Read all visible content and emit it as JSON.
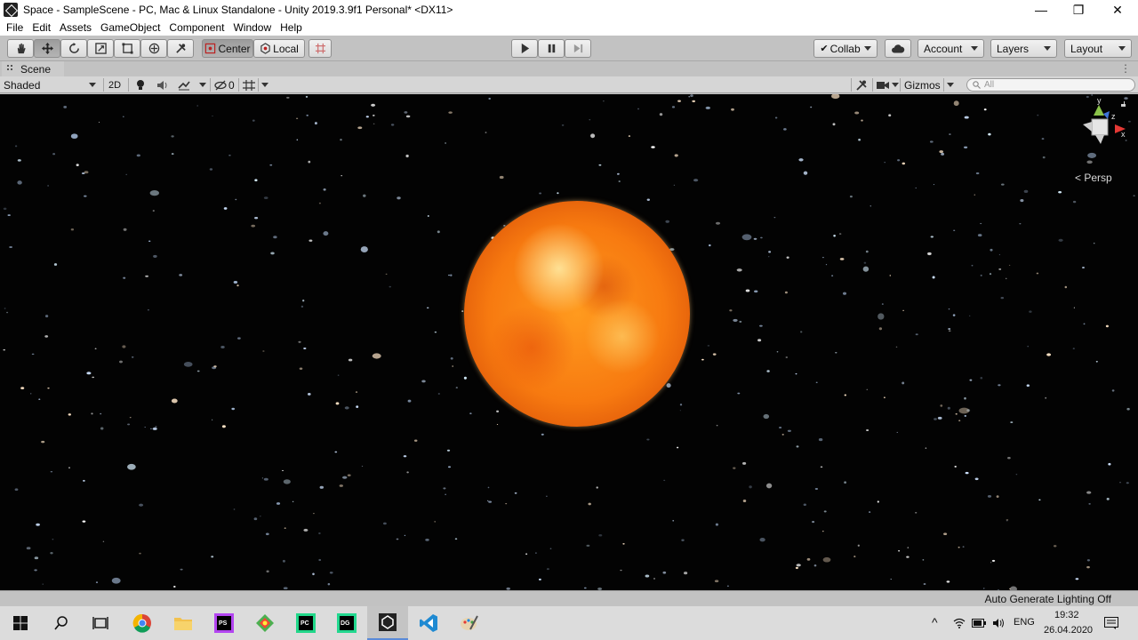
{
  "window": {
    "title": "Space - SampleScene - PC, Mac & Linux Standalone - Unity 2019.3.9f1 Personal* <DX11>",
    "minimize": "—",
    "restore": "❐",
    "close": "✕"
  },
  "menu": [
    "File",
    "Edit",
    "Assets",
    "GameObject",
    "Component",
    "Window",
    "Help"
  ],
  "toolbar": {
    "center_label": "Center",
    "local_label": "Local",
    "collab_label": "Collab",
    "account_label": "Account",
    "layers_label": "Layers",
    "layout_label": "Layout"
  },
  "scene_tab": {
    "label": "Scene",
    "menu_dots": "⋮"
  },
  "scene_bar": {
    "shading_mode": "Shaded",
    "mode_2d": "2D",
    "hidden_count": "0",
    "gizmos_label": "Gizmos",
    "search_placeholder": "All"
  },
  "viewport": {
    "projection_label": "Persp",
    "axis_y": "y",
    "axis_z": "z",
    "axis_x": "x"
  },
  "status": {
    "lighting": "Auto Generate Lighting Off"
  },
  "taskbar": {
    "language": "ENG",
    "time": "19:32",
    "date": "26.04.2020",
    "apps": [
      "start",
      "search",
      "task-view",
      "chrome",
      "explorer",
      "photoshop",
      "git",
      "pycharm",
      "datagrip",
      "unity",
      "vscode",
      "paint"
    ]
  },
  "colors": {
    "accent": "#5a8ad8",
    "sun_core": "#f77a10",
    "viewport_bg": "#030303"
  }
}
